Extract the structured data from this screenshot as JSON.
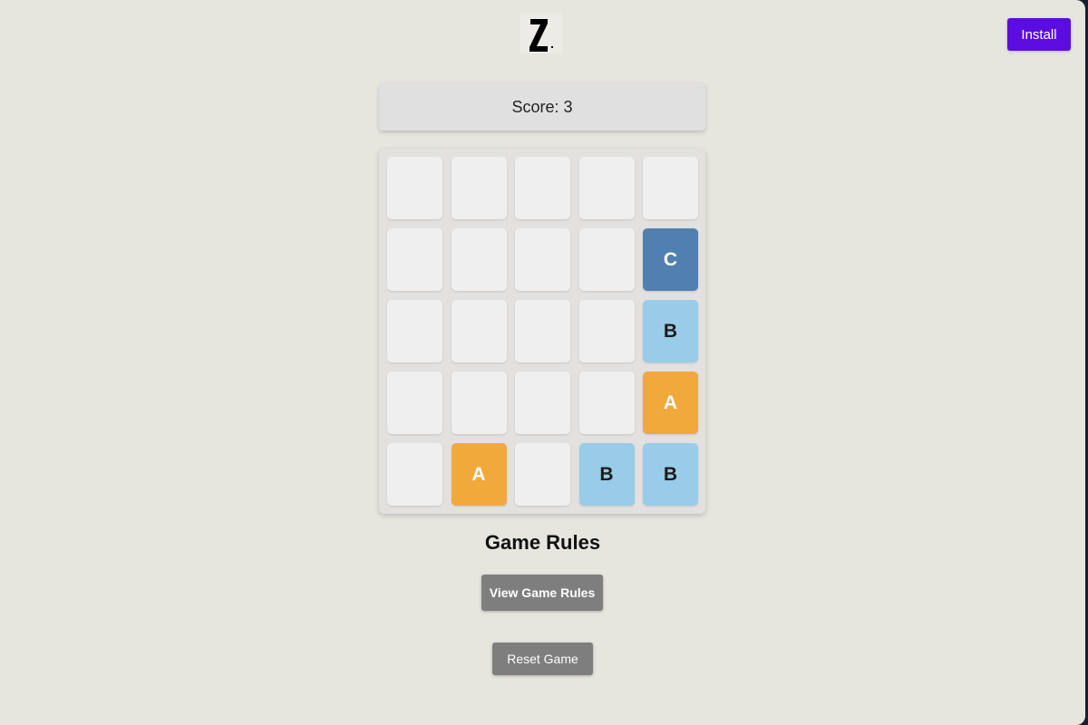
{
  "header": {
    "logo_icon": "z-logo-icon",
    "install_label": "Install"
  },
  "score": {
    "label": "Score: 3"
  },
  "board": {
    "rows": [
      [
        "",
        "",
        "",
        "",
        ""
      ],
      [
        "",
        "",
        "",
        "",
        "C"
      ],
      [
        "",
        "",
        "",
        "",
        "B"
      ],
      [
        "",
        "",
        "",
        "",
        "A"
      ],
      [
        "",
        "A",
        "",
        "B",
        "B"
      ]
    ]
  },
  "colors": {
    "A": "#f2a93b",
    "B": "#99cce8",
    "C": "#5080b0",
    "empty": "#efefef",
    "install_accent": "#5b0ddf"
  },
  "rules": {
    "title": "Game Rules",
    "view_label": "View Game Rules"
  },
  "reset": {
    "label": "Reset Game"
  }
}
